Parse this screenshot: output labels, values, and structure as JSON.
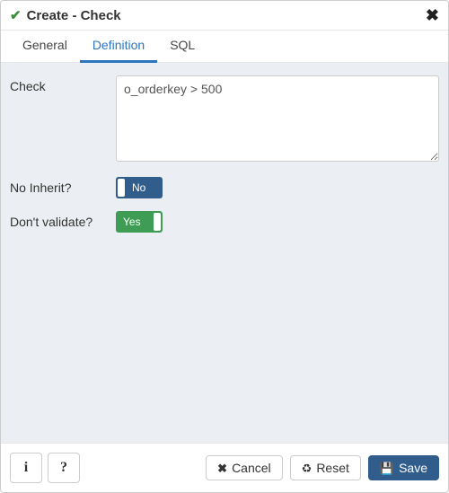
{
  "header": {
    "title": "Create - Check",
    "check_icon": "check-icon",
    "close_icon": "close-icon"
  },
  "tabs": {
    "items": [
      {
        "label": "General",
        "active": false
      },
      {
        "label": "Definition",
        "active": true
      },
      {
        "label": "SQL",
        "active": false
      }
    ]
  },
  "form": {
    "check": {
      "label": "Check",
      "value": "o_orderkey > 500"
    },
    "no_inherit": {
      "label": "No Inherit?",
      "state": "No"
    },
    "dont_validate": {
      "label": "Don't validate?",
      "state": "Yes"
    }
  },
  "footer": {
    "info_icon": "info-icon",
    "help_icon": "help-icon",
    "cancel": "Cancel",
    "reset": "Reset",
    "save": "Save"
  },
  "icons": {
    "cancel_glyph": "✖",
    "reset_glyph": "♻",
    "save_glyph": "💾",
    "header_check_glyph": "✔",
    "header_close_glyph": "✖"
  }
}
